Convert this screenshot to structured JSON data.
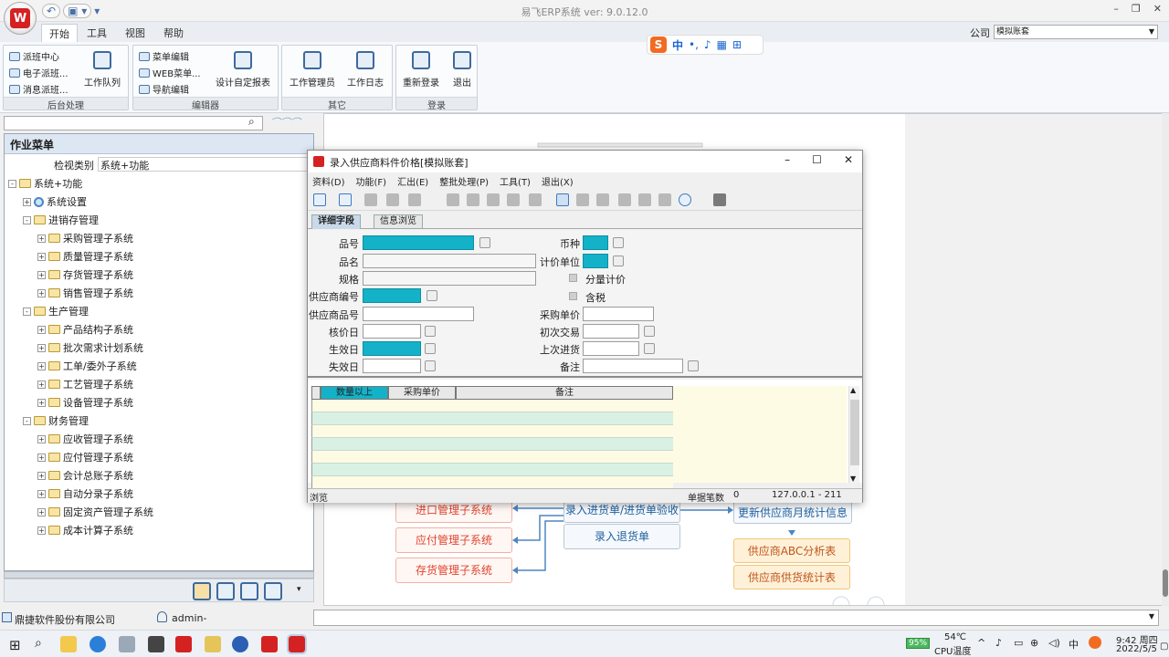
{
  "app": {
    "title": "易飞ERP系统 ver: 9.0.12.0",
    "company_label": "公司",
    "company_value": "模拟账套"
  },
  "ribbon_tabs": [
    {
      "label": "开始",
      "active": true
    },
    {
      "label": "工具"
    },
    {
      "label": "视图"
    },
    {
      "label": "帮助"
    }
  ],
  "ribbon": {
    "g1": {
      "name": "后台处理",
      "items": [
        "派班中心",
        "电子派班...",
        "消息派班..."
      ],
      "big": "工作队列"
    },
    "g2": {
      "name": "编辑器",
      "items": [
        "菜单编辑",
        "WEB菜单...",
        "导航编辑"
      ],
      "big": "设计自定报表"
    },
    "g3": {
      "name": "其它",
      "big1": "工作管理员",
      "big2": "工作日志"
    },
    "g4": {
      "name": "登录",
      "big1": "重新登录",
      "big2": "退出"
    }
  },
  "ime": {
    "label": "中"
  },
  "left": {
    "menu_title": "作业菜单",
    "viewtype_label": "检视类别",
    "viewtype_value": "系统+功能",
    "tree": [
      {
        "label": "系统+功能",
        "lvl": 0,
        "exp": "-",
        "ic": "fold"
      },
      {
        "label": "系统设置",
        "lvl": 1,
        "exp": "+",
        "ic": "gear"
      },
      {
        "label": "进销存管理",
        "lvl": 1,
        "exp": "-",
        "ic": "fold"
      },
      {
        "label": "采购管理子系统",
        "lvl": 2,
        "exp": "+",
        "ic": "fold"
      },
      {
        "label": "质量管理子系统",
        "lvl": 2,
        "exp": "+",
        "ic": "fold"
      },
      {
        "label": "存货管理子系统",
        "lvl": 2,
        "exp": "+",
        "ic": "fold"
      },
      {
        "label": "销售管理子系统",
        "lvl": 2,
        "exp": "+",
        "ic": "fold"
      },
      {
        "label": "生产管理",
        "lvl": 1,
        "exp": "-",
        "ic": "fold"
      },
      {
        "label": "产品结构子系统",
        "lvl": 2,
        "exp": "+",
        "ic": "fold"
      },
      {
        "label": "批次需求计划系统",
        "lvl": 2,
        "exp": "+",
        "ic": "fold"
      },
      {
        "label": "工单/委外子系统",
        "lvl": 2,
        "exp": "+",
        "ic": "fold"
      },
      {
        "label": "工艺管理子系统",
        "lvl": 2,
        "exp": "+",
        "ic": "fold"
      },
      {
        "label": "设备管理子系统",
        "lvl": 2,
        "exp": "+",
        "ic": "fold"
      },
      {
        "label": "财务管理",
        "lvl": 1,
        "exp": "-",
        "ic": "fold"
      },
      {
        "label": "应收管理子系统",
        "lvl": 2,
        "exp": "+",
        "ic": "fold"
      },
      {
        "label": "应付管理子系统",
        "lvl": 2,
        "exp": "+",
        "ic": "fold"
      },
      {
        "label": "会计总账子系统",
        "lvl": 2,
        "exp": "+",
        "ic": "fold"
      },
      {
        "label": "自动分录子系统",
        "lvl": 2,
        "exp": "+",
        "ic": "fold"
      },
      {
        "label": "固定资产管理子系统",
        "lvl": 2,
        "exp": "+",
        "ic": "fold"
      },
      {
        "label": "成本计算子系统",
        "lvl": 2,
        "exp": "+",
        "ic": "fold"
      }
    ]
  },
  "flow": {
    "jinkou": "进口管理子系统",
    "yingfu": "应付管理子系统",
    "cunhuo": "存货管理子系统",
    "luru_jin": "录入进货单/进货单验收",
    "luru_tui": "录入退货单",
    "gengxin": "更新供应商月统计信息",
    "abc": "供应商ABC分析表",
    "tongji": "供应商供货统计表"
  },
  "status": {
    "company": "鼎捷软件股份有限公司",
    "user": "admin-"
  },
  "dialog": {
    "title": "录入供应商料件价格[模拟账套]",
    "menu": [
      "资料(D)",
      "功能(F)",
      "汇出(E)",
      "整批处理(P)",
      "工具(T)",
      "退出(X)"
    ],
    "tabs": [
      "详细字段",
      "信息浏览"
    ],
    "labels": {
      "pinhao": "品号",
      "pinming": "品名",
      "guige": "规格",
      "gys_bh": "供应商编号",
      "gys_ph": "供应商品号",
      "hejia": "核价日",
      "shengxiao": "生效日",
      "shixiao": "失效日",
      "bizhong": "币种",
      "jijia": "计价单位",
      "fenliang": "分量计价",
      "hanshui": "含税",
      "caigou_dj": "采购单价",
      "chuci": "初次交易",
      "shangci": "上次进货",
      "beizhu": "备注"
    },
    "grid_headers": [
      "数量以上",
      "采购单价",
      "备注"
    ],
    "status": {
      "left": "浏览",
      "count_label": "单据笔数",
      "count": "0",
      "ip": "127.0.0.1 - 211"
    }
  },
  "tray": {
    "battery": "95%",
    "temp": "54℃",
    "temp_label": "CPU温度",
    "ime": "中",
    "time": "9:42 周四",
    "date": "2022/5/5"
  }
}
